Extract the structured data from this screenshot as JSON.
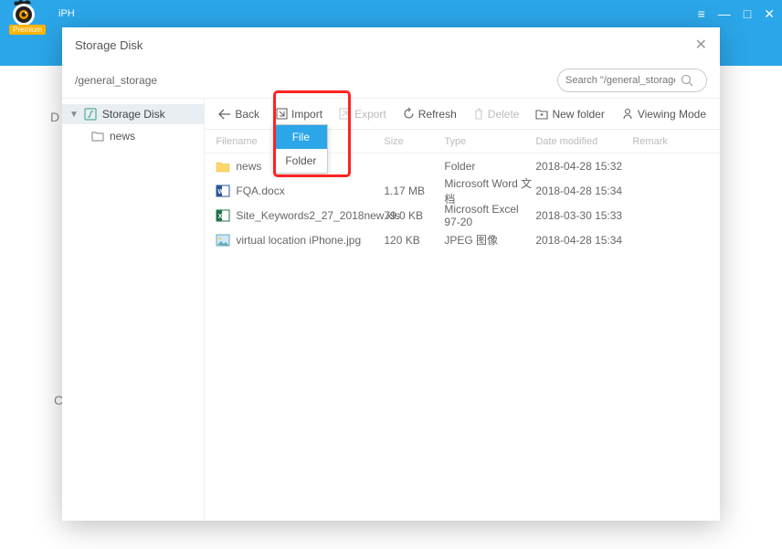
{
  "topbar": {
    "app_label": "iPH"
  },
  "dialog": {
    "title": "Storage Disk",
    "path": "/general_storage",
    "search_placeholder": "Search \"/general_storage\""
  },
  "sidebar": {
    "root": "Storage Disk",
    "child": "news"
  },
  "toolbar": {
    "back": "Back",
    "import": "Import",
    "export": "Export",
    "refresh": "Refresh",
    "delete": "Delete",
    "newfolder": "New folder",
    "viewing": "Viewing Mode"
  },
  "dropdown": {
    "file": "File",
    "folder": "Folder"
  },
  "columns": {
    "name": "Filename",
    "size": "Size",
    "type": "Type",
    "date": "Date modified",
    "remark": "Remark"
  },
  "rows": [
    {
      "name": "news",
      "size": "",
      "type": "Folder",
      "date": "2018-04-28 15:32",
      "icon": "folder"
    },
    {
      "name": "FQA.docx",
      "size": "1.17 MB",
      "type": "Microsoft Word 文档",
      "date": "2018-04-28 15:34",
      "icon": "word"
    },
    {
      "name": "Site_Keywords2_27_2018new.xls",
      "size": "79.0 KB",
      "type": "Microsoft Excel 97-20",
      "date": "2018-03-30 15:33",
      "icon": "excel"
    },
    {
      "name": "virtual location iPhone.jpg",
      "size": "120 KB",
      "type": "JPEG 图像",
      "date": "2018-04-28 15:34",
      "icon": "image"
    }
  ]
}
